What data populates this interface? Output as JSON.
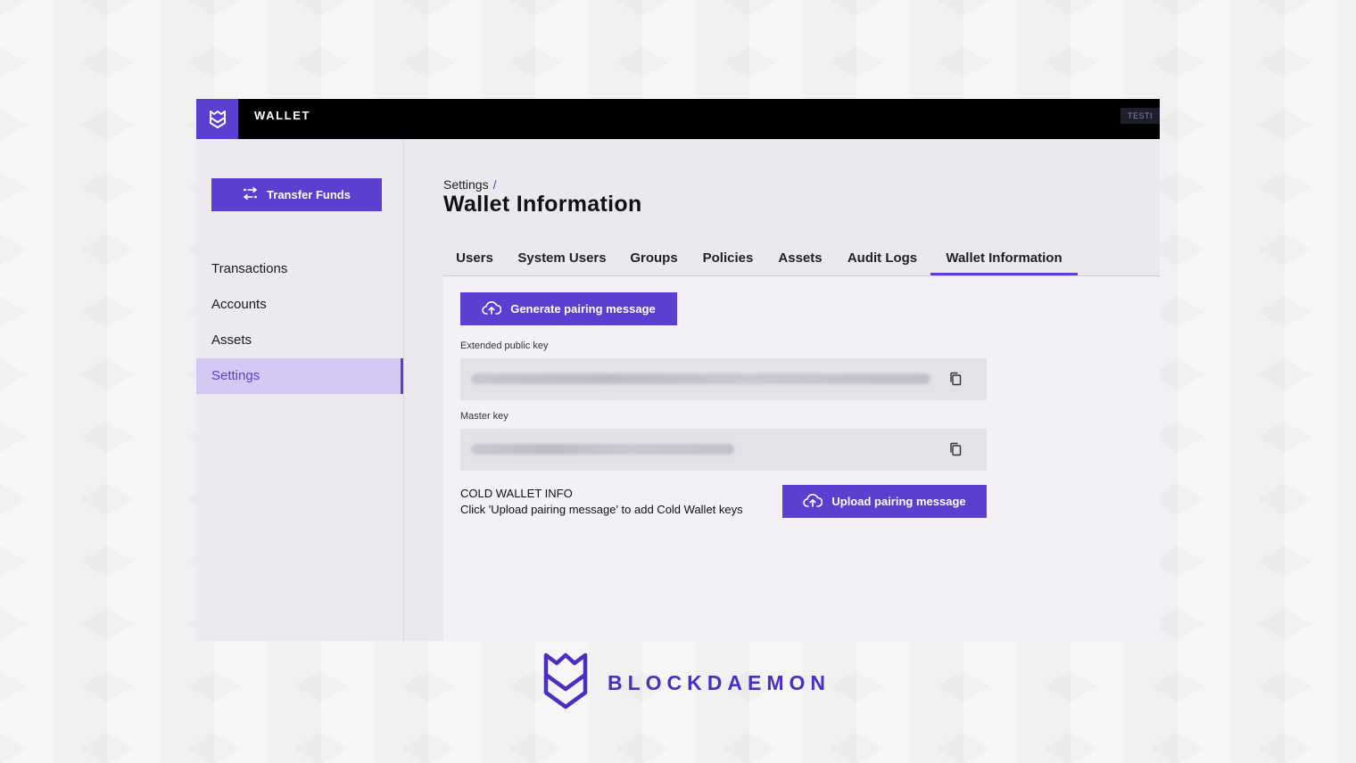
{
  "colors": {
    "accent": "#5b3fd1",
    "topbar": "#000000",
    "active_nav_bg": "#d4c9f2",
    "brand": "#4b2fc0"
  },
  "topbar": {
    "app_title": "WALLET",
    "env_badge": "TESTI",
    "logo_icon": "blockdaemon-logo-icon"
  },
  "sidebar": {
    "transfer_button": {
      "label": "Transfer Funds",
      "icon": "swap-arrows-icon"
    },
    "items": [
      {
        "label": "Transactions",
        "active": false
      },
      {
        "label": "Accounts",
        "active": false
      },
      {
        "label": "Assets",
        "active": false
      },
      {
        "label": "Settings",
        "active": true
      }
    ]
  },
  "header": {
    "breadcrumb": "Settings",
    "breadcrumb_separator": "/",
    "title": "Wallet Information"
  },
  "tabs": [
    {
      "label": "Users",
      "active": false
    },
    {
      "label": "System Users",
      "active": false
    },
    {
      "label": "Groups",
      "active": false
    },
    {
      "label": "Policies",
      "active": false
    },
    {
      "label": "Assets",
      "active": false
    },
    {
      "label": "Audit Logs",
      "active": false
    },
    {
      "label": "Wallet Information",
      "active": true
    }
  ],
  "panel": {
    "generate_button": {
      "label": "Generate pairing message",
      "icon": "cloud-upload-icon"
    },
    "extended_public_key": {
      "label": "Extended public key",
      "icon": "copy-icon"
    },
    "master_key": {
      "label": "Master key",
      "icon": "copy-icon"
    },
    "cold_wallet": {
      "title": "COLD WALLET INFO",
      "description": "Click 'Upload pairing message' to add Cold Wallet keys"
    },
    "upload_button": {
      "label": "Upload pairing message",
      "icon": "cloud-upload-icon"
    }
  },
  "brand": {
    "name": "BLOCKDAEMON",
    "logo_icon": "blockdaemon-logo-icon"
  }
}
